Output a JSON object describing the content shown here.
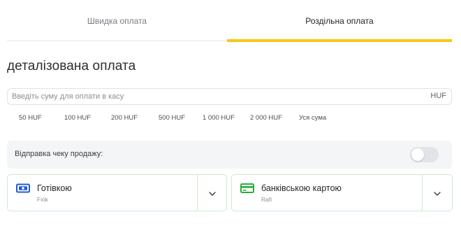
{
  "tabs": {
    "quick_label": "Швидка оплата",
    "split_label": "Роздільна оплата",
    "active": "split"
  },
  "title": "деталізована оплата",
  "amount": {
    "placeholder": "Введіть суму для оплати в касу",
    "value": "",
    "currency": "HUF"
  },
  "quick_amounts": [
    "50 HUF",
    "100 HUF",
    "200 HUF",
    "500 HUF",
    "1 000 HUF",
    "2 000 HUF",
    "Уся сума"
  ],
  "receipt": {
    "label": "Відправка чеку продажу:",
    "enabled": false
  },
  "payment_methods": [
    {
      "title": "Готівкою",
      "subtitle": "Fiók",
      "icon": "cash-icon",
      "icon_color": "#1f5bd6"
    },
    {
      "title": "банківською картою",
      "subtitle": "Rafi",
      "icon": "credit-card-icon",
      "icon_color": "#27ae3b"
    }
  ],
  "colors": {
    "accent": "#f5c915",
    "card_border": "#cfe9cf",
    "muted_bg": "#f4f5f7"
  }
}
